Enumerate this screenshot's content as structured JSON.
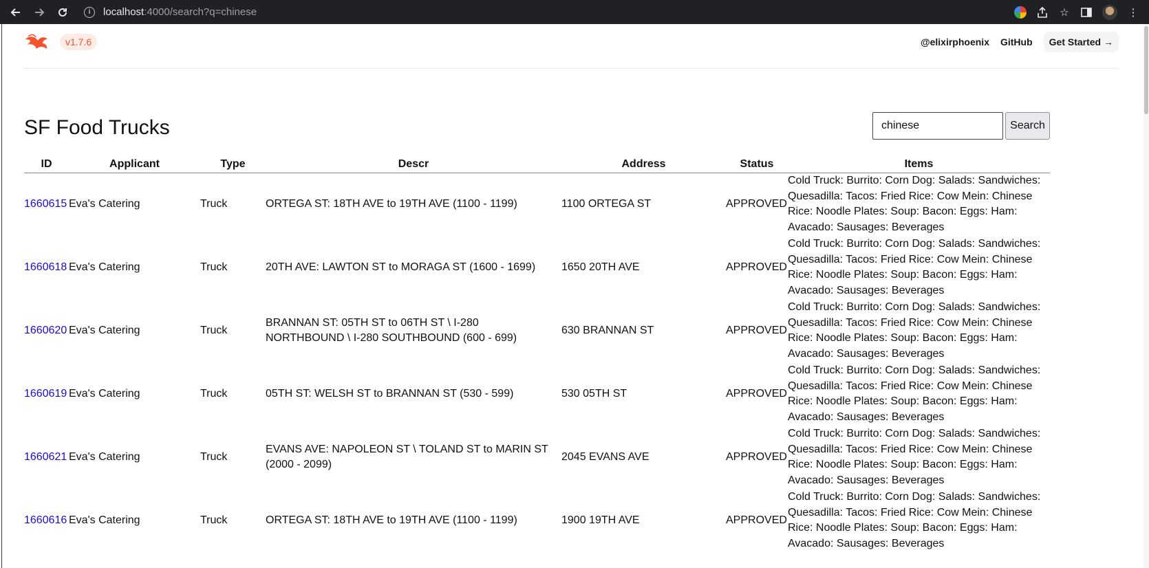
{
  "browser": {
    "url_host": "localhost",
    "url_rest": ":4000/search?q=chinese"
  },
  "header": {
    "version": "v1.7.6",
    "links": [
      "@elixirphoenix",
      "GitHub"
    ],
    "cta": "Get Started →"
  },
  "page": {
    "title": "SF Food Trucks"
  },
  "search": {
    "value": "chinese",
    "button": "Search"
  },
  "table": {
    "columns": [
      "ID",
      "Applicant",
      "Type",
      "Descr",
      "Address",
      "Status",
      "Items"
    ],
    "rows": [
      {
        "id": "1660615",
        "applicant": "Eva's Catering",
        "type": "Truck",
        "descr": "ORTEGA ST: 18TH AVE to 19TH AVE (1100 - 1199)",
        "address": "1100 ORTEGA ST",
        "status": "APPROVED",
        "items": "Cold Truck: Burrito: Corn Dog: Salads: Sandwiches: Quesadilla: Tacos: Fried Rice: Cow Mein: Chinese Rice: Noodle Plates: Soup: Bacon: Eggs: Ham: Avacado: Sausages: Beverages"
      },
      {
        "id": "1660618",
        "applicant": "Eva's Catering",
        "type": "Truck",
        "descr": "20TH AVE: LAWTON ST to MORAGA ST (1600 - 1699)",
        "address": "1650 20TH AVE",
        "status": "APPROVED",
        "items": "Cold Truck: Burrito: Corn Dog: Salads: Sandwiches: Quesadilla: Tacos: Fried Rice: Cow Mein: Chinese Rice: Noodle Plates: Soup: Bacon: Eggs: Ham: Avacado: Sausages: Beverages"
      },
      {
        "id": "1660620",
        "applicant": "Eva's Catering",
        "type": "Truck",
        "descr": "BRANNAN ST: 05TH ST to 06TH ST \\ I-280 NORTHBOUND \\ I-280 SOUTHBOUND (600 - 699)",
        "address": "630 BRANNAN ST",
        "status": "APPROVED",
        "items": "Cold Truck: Burrito: Corn Dog: Salads: Sandwiches: Quesadilla: Tacos: Fried Rice: Cow Mein: Chinese Rice: Noodle Plates: Soup: Bacon: Eggs: Ham: Avacado: Sausages: Beverages"
      },
      {
        "id": "1660619",
        "applicant": "Eva's Catering",
        "type": "Truck",
        "descr": "05TH ST: WELSH ST to BRANNAN ST (530 - 599)",
        "address": "530 05TH ST",
        "status": "APPROVED",
        "items": "Cold Truck: Burrito: Corn Dog: Salads: Sandwiches: Quesadilla: Tacos: Fried Rice: Cow Mein: Chinese Rice: Noodle Plates: Soup: Bacon: Eggs: Ham: Avacado: Sausages: Beverages"
      },
      {
        "id": "1660621",
        "applicant": "Eva's Catering",
        "type": "Truck",
        "descr": "EVANS AVE: NAPOLEON ST \\ TOLAND ST to MARIN ST (2000 - 2099)",
        "address": "2045 EVANS AVE",
        "status": "APPROVED",
        "items": "Cold Truck: Burrito: Corn Dog: Salads: Sandwiches: Quesadilla: Tacos: Fried Rice: Cow Mein: Chinese Rice: Noodle Plates: Soup: Bacon: Eggs: Ham: Avacado: Sausages: Beverages"
      },
      {
        "id": "1660616",
        "applicant": "Eva's Catering",
        "type": "Truck",
        "descr": "ORTEGA ST: 18TH AVE to 19TH AVE (1100 - 1199)",
        "address": "1900 19TH AVE",
        "status": "APPROVED",
        "items": "Cold Truck: Burrito: Corn Dog: Salads: Sandwiches: Quesadilla: Tacos: Fried Rice: Cow Mein: Chinese Rice: Noodle Plates: Soup: Bacon: Eggs: Ham: Avacado: Sausages: Beverages"
      }
    ]
  },
  "icons": {
    "back": "back-arrow-icon",
    "forward": "forward-arrow-icon",
    "reload": "reload-icon",
    "info": "info-icon",
    "google": "google-icon",
    "share": "share-icon",
    "bookmark": "star-icon",
    "sidepanel": "side-panel-icon",
    "profile": "avatar",
    "menu": "kebab-menu-icon",
    "logo": "phoenix-logo-icon"
  },
  "colors": {
    "chrome_bg": "#202124",
    "brand_orange": "#f2542d",
    "link_blue": "#1a0dcc"
  }
}
